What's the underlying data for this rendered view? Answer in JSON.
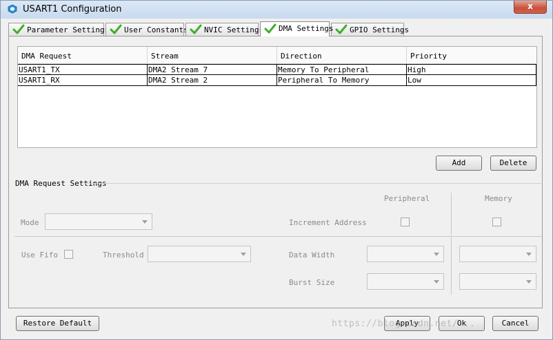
{
  "window": {
    "title": "USART1 Configuration",
    "close_label": "x"
  },
  "tabs": [
    {
      "label": "Parameter Settings",
      "active": false
    },
    {
      "label": "User Constants",
      "active": false
    },
    {
      "label": "NVIC Settings",
      "active": false
    },
    {
      "label": "DMA Settings",
      "active": true
    },
    {
      "label": "GPIO Settings",
      "active": false
    }
  ],
  "table": {
    "headers": [
      "DMA Request",
      "Stream",
      "Direction",
      "Priority"
    ],
    "rows": [
      [
        "USART1_TX",
        "DMA2 Stream 7",
        "Memory To Peripheral",
        "High"
      ],
      [
        "USART1_RX",
        "DMA2 Stream 2",
        "Peripheral To Memory",
        "Low"
      ]
    ]
  },
  "table_buttons": {
    "add": "Add",
    "delete": "Delete"
  },
  "settings": {
    "group_title": "DMA Request Settings",
    "peripheral_header": "Peripheral",
    "memory_header": "Memory",
    "mode_label": "Mode",
    "increment_label": "Increment Address",
    "use_fifo_label": "Use Fifo",
    "threshold_label": "Threshold",
    "data_width_label": "Data Width",
    "burst_size_label": "Burst Size"
  },
  "footer": {
    "restore": "Restore Default",
    "apply": "Apply",
    "ok": "Ok",
    "cancel": "Cancel"
  },
  "watermark": "https://blog.csdn.net/...",
  "colors": {
    "check_green": "#3fae2a",
    "close_red": "#c7503b"
  },
  "icons": {
    "tab_status": "green-check-icon",
    "dropdown": "chevron-down-icon"
  }
}
